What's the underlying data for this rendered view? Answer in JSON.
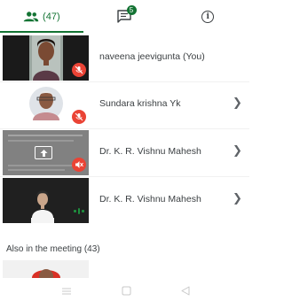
{
  "tabs": [
    {
      "icon": "people-icon",
      "count": "(47)",
      "active": true
    },
    {
      "icon": "chat-icon",
      "badge": "5",
      "active": false
    },
    {
      "icon": "info-icon",
      "active": false
    }
  ],
  "participants": [
    {
      "name": "naveena jeevigunta (You)",
      "tile": "camera-video",
      "muted": true,
      "has_chevron": false
    },
    {
      "name": "Sundara krishna Yk",
      "tile": "profile-photo",
      "muted": true,
      "has_chevron": true
    },
    {
      "name": "Dr. K. R. Vishnu Mahesh",
      "tile": "screen-presentation",
      "muted": true,
      "has_chevron": true
    },
    {
      "name": "Dr. K. R. Vishnu Mahesh",
      "tile": "camera-video-dark",
      "muted": false,
      "speaking": true,
      "has_chevron": true
    }
  ],
  "section": {
    "label": "Also in the meeting (43)"
  },
  "navbar": {
    "items": [
      "menu-icon",
      "home-icon",
      "back-icon"
    ]
  },
  "colors": {
    "accent": "#137333",
    "mute": "#ea4335",
    "speaking": "#1e8e3e"
  }
}
